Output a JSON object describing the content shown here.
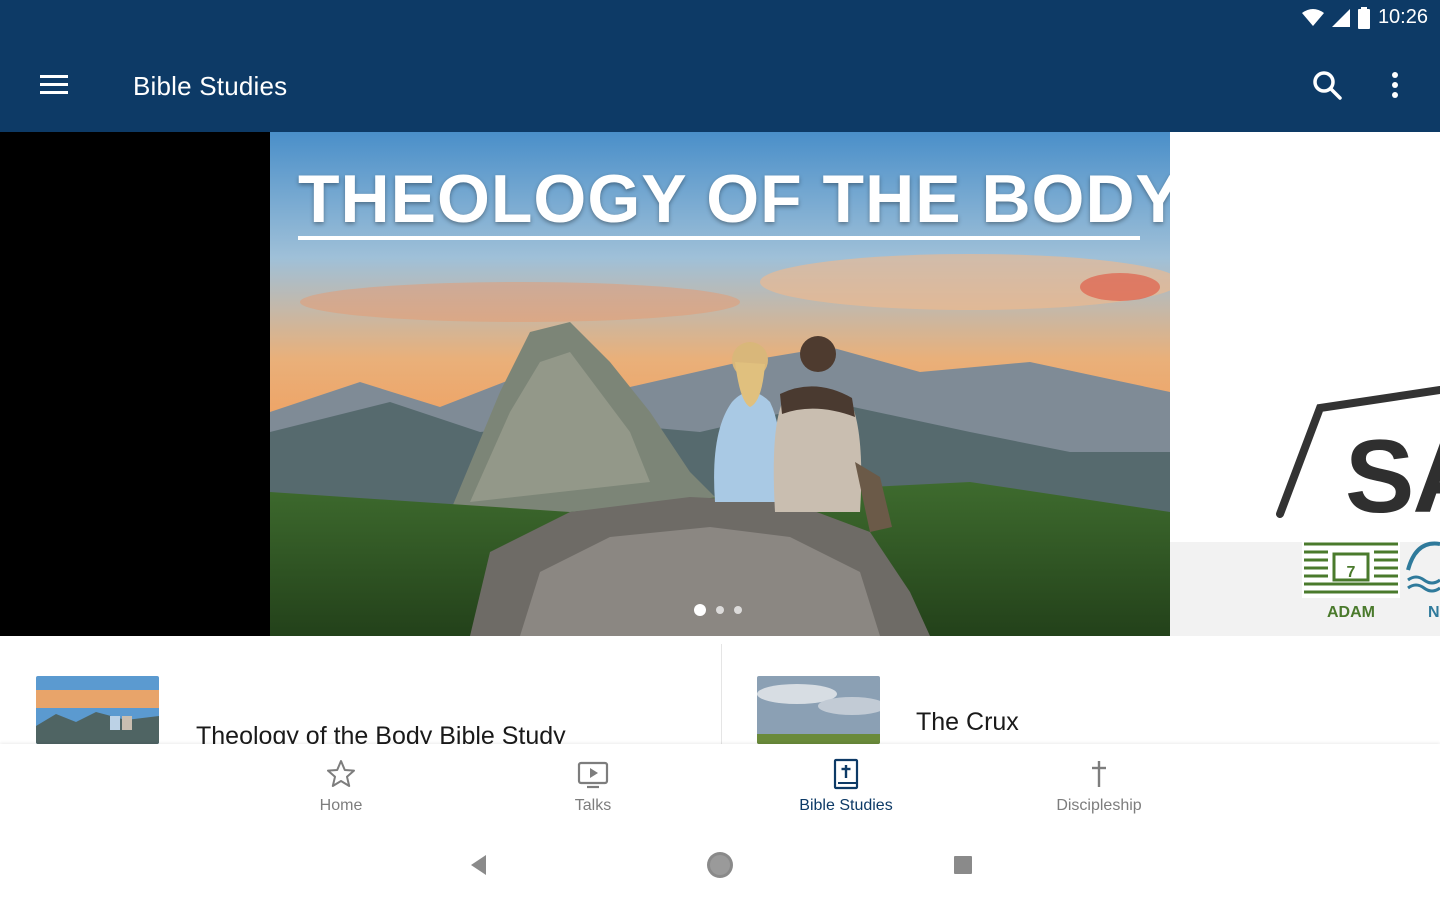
{
  "status_bar": {
    "time": "10:26"
  },
  "app_bar": {
    "title": "Bible Studies"
  },
  "carousel": {
    "hero_title": "THEOLOGY OF THE BODY",
    "slide_count": 3,
    "active_slide": 1,
    "next_slide_partial_text": "SA",
    "next_slide_badge_label": "ADAM",
    "next_slide_badge_label_2": "N"
  },
  "cards": [
    {
      "title": "Theology of the Body Bible Study"
    },
    {
      "title": "The Crux"
    }
  ],
  "bottom_nav": {
    "items": [
      {
        "label": "Home",
        "icon": "star-icon",
        "active": false
      },
      {
        "label": "Talks",
        "icon": "tv-play-icon",
        "active": false
      },
      {
        "label": "Bible Studies",
        "icon": "bible-icon",
        "active": true
      },
      {
        "label": "Discipleship",
        "icon": "cross-icon",
        "active": false
      }
    ]
  },
  "colors": {
    "primary": "#0d3a66",
    "inactive": "#7d7d7d",
    "badge_green": "#4a7a2c"
  }
}
